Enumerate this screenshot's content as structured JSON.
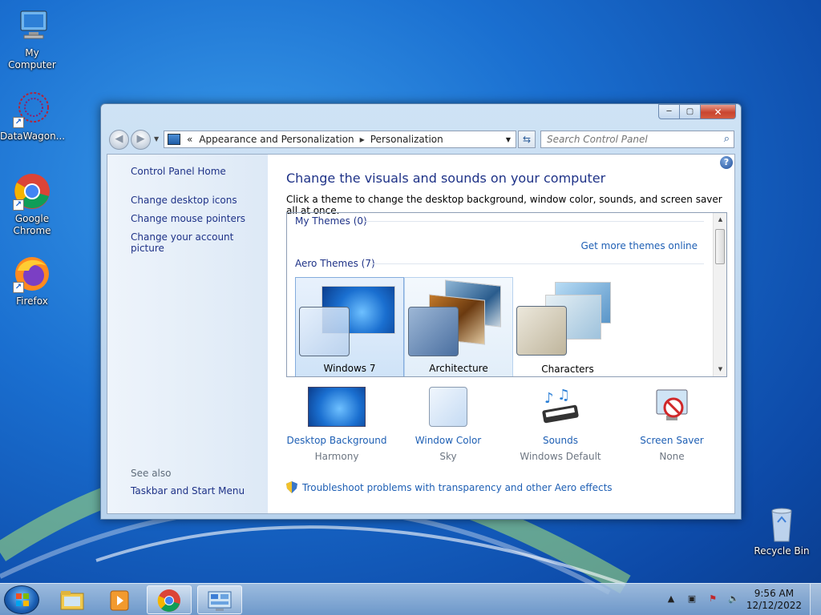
{
  "desktop": {
    "icons": [
      {
        "label": "My Computer",
        "icon": "computer-icon"
      },
      {
        "label": "DataWagon...",
        "icon": "datawagon-icon"
      },
      {
        "label": "Google Chrome",
        "icon": "chrome-icon"
      },
      {
        "label": "Firefox",
        "icon": "firefox-icon"
      },
      {
        "label": "Recycle Bin",
        "icon": "recycle-bin-icon"
      }
    ]
  },
  "window": {
    "controls": {
      "minimize": "─",
      "maximize": "▢",
      "close": "✕"
    },
    "breadcrumb": {
      "overflow": "«",
      "items": [
        "Appearance and Personalization",
        "Personalization"
      ]
    },
    "search_placeholder": "Search Control Panel"
  },
  "left_pane": {
    "home_link": "Control Panel Home",
    "links": [
      "Change desktop icons",
      "Change mouse pointers",
      "Change your account picture"
    ],
    "see_also_label": "See also",
    "see_also_links": [
      "Taskbar and Start Menu"
    ]
  },
  "main": {
    "heading": "Change the visuals and sounds on your computer",
    "subheading": "Click a theme to change the desktop background, window color, sounds, and screen saver all at once.",
    "my_themes_label": "My Themes (0)",
    "get_more_link": "Get more themes online",
    "aero_themes_label": "Aero Themes (7)",
    "themes": [
      {
        "name": "Windows 7",
        "state": "selected"
      },
      {
        "name": "Architecture",
        "state": "hover"
      },
      {
        "name": "Characters",
        "state": "normal"
      }
    ],
    "options": [
      {
        "label": "Desktop Background",
        "value": "Harmony",
        "icon": "desktop-background-icon"
      },
      {
        "label": "Window Color",
        "value": "Sky",
        "icon": "window-color-icon"
      },
      {
        "label": "Sounds",
        "value": "Windows Default",
        "icon": "sounds-icon"
      },
      {
        "label": "Screen Saver",
        "value": "None",
        "icon": "screen-saver-icon"
      }
    ],
    "troubleshoot_link": "Troubleshoot problems with transparency and other Aero effects"
  },
  "taskbar": {
    "time": "9:56 AM",
    "date": "12/12/2022",
    "tray_expand": "▲"
  }
}
